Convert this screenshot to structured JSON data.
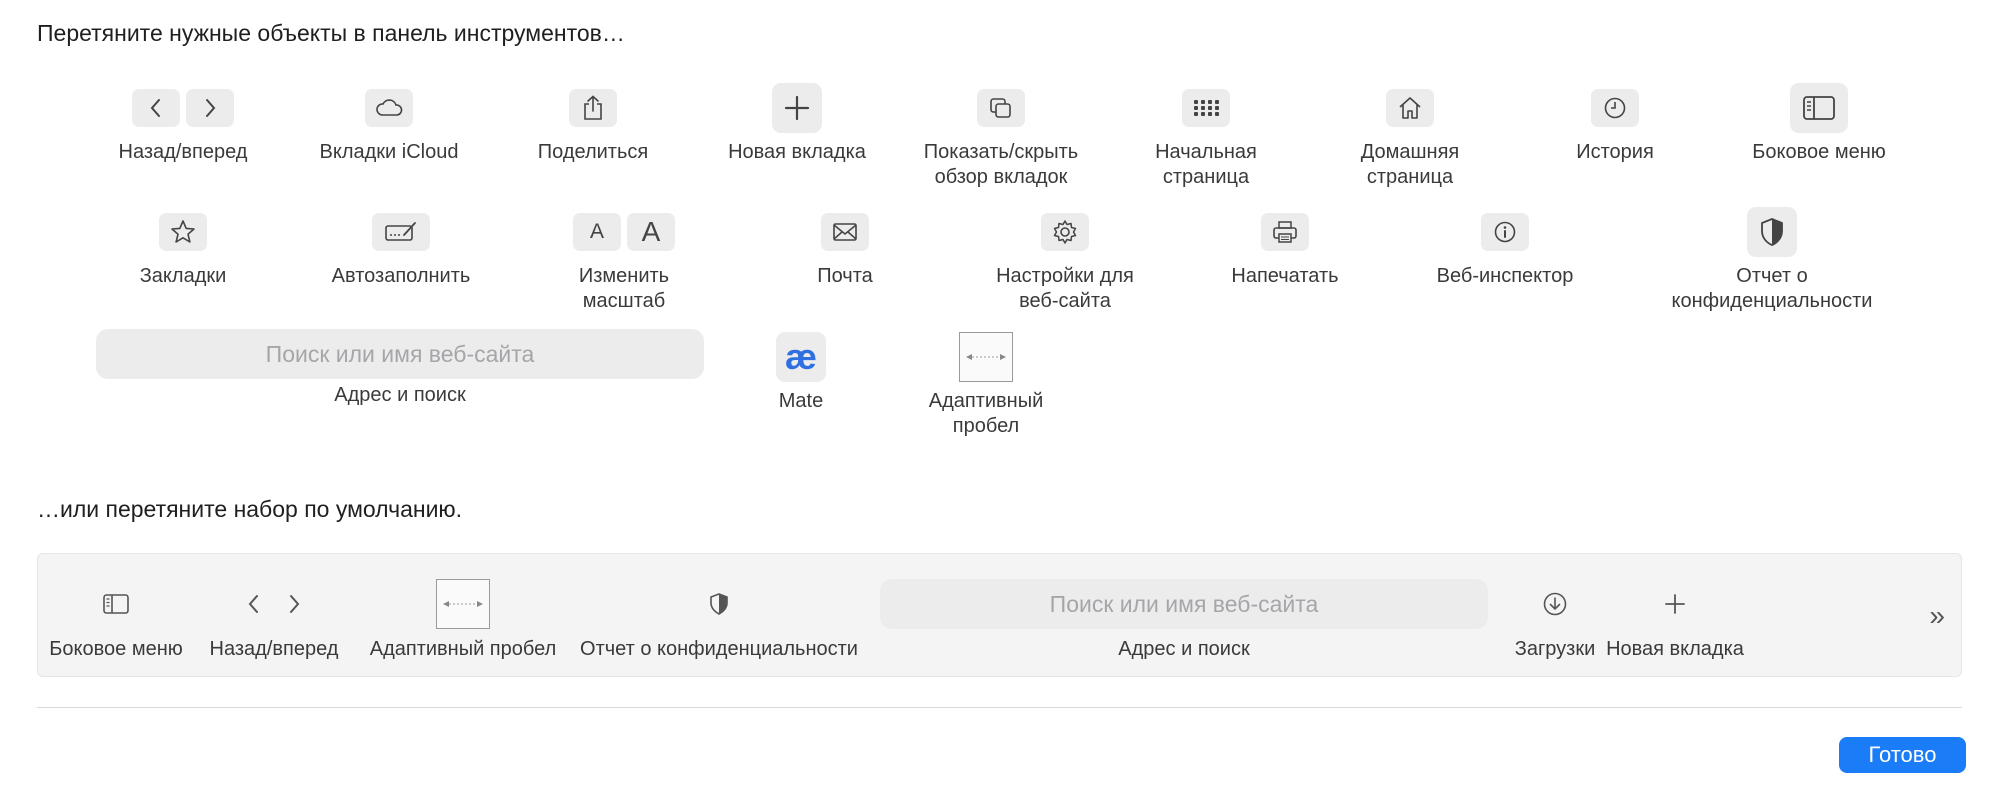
{
  "palette": {
    "heading": "Перетяните нужные объекты в панель инструментов…",
    "items": [
      {
        "label": "Назад/вперед"
      },
      {
        "label": "Вкладки iCloud"
      },
      {
        "label": "Поделиться"
      },
      {
        "label": "Новая вкладка"
      },
      {
        "label": "Показать/скрыть\nобзор вкладок"
      },
      {
        "label": "Начальная\nстраница"
      },
      {
        "label": "Домашняя\nстраница"
      },
      {
        "label": "История"
      },
      {
        "label": "Боковое меню"
      },
      {
        "label": "Закладки"
      },
      {
        "label": "Автозаполнить"
      },
      {
        "label": "Изменить\nмасштаб",
        "glyph_small": "A",
        "glyph_large": "A"
      },
      {
        "label": "Почта"
      },
      {
        "label": "Настройки для\nвеб-сайта"
      },
      {
        "label": "Напечатать"
      },
      {
        "label": "Веб-инспектор"
      },
      {
        "label": "Отчет о\nконфиденциальности"
      },
      {
        "label": "Mate",
        "glyph": "æ"
      },
      {
        "label": "Адаптивный\nпробел"
      }
    ],
    "address": {
      "placeholder": "Поиск или имя веб-сайта",
      "label": "Адрес и поиск"
    }
  },
  "default_set": {
    "heading": "…или перетяните набор по умолчанию.",
    "items": [
      {
        "label": "Боковое меню"
      },
      {
        "label": "Назад/вперед"
      },
      {
        "label": "Адаптивный пробел"
      },
      {
        "label": "Отчет о конфиденциальности"
      },
      {
        "label": "Загрузки"
      },
      {
        "label": "Новая вкладка"
      }
    ],
    "address": {
      "placeholder": "Поиск или имя веб-сайта",
      "label": "Адрес и поиск"
    },
    "overflow": "»"
  },
  "done_button": "Готово",
  "colors": {
    "accent": "#1a7cf7",
    "mate": "#2f6fe0"
  }
}
